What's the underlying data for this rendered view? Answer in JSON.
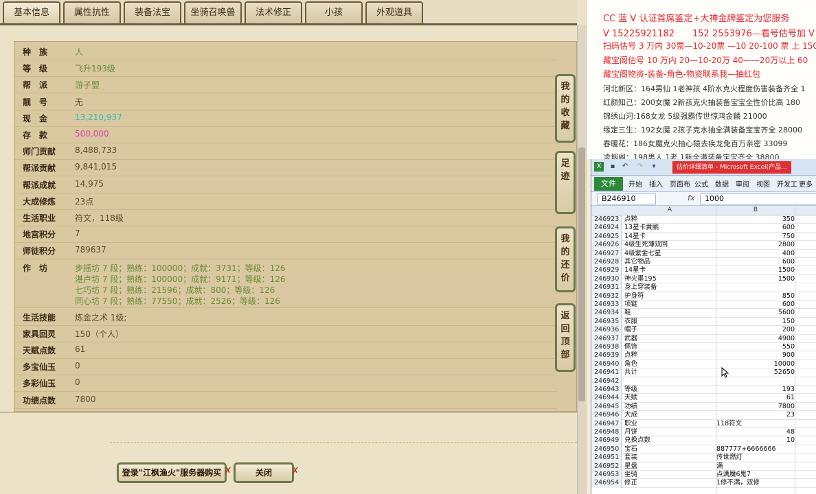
{
  "tabs": [
    "基本信息",
    "属性抗性",
    "装备法宝",
    "坐骑召唤兽",
    "法术修正",
    "小孩",
    "外观道具"
  ],
  "info_rows": [
    {
      "label": "种　族",
      "value": "人",
      "style": "green"
    },
    {
      "label": "等　级",
      "value": "飞升193级",
      "style": "green"
    },
    {
      "label": "帮　派",
      "value": "游子盟",
      "style": "green"
    },
    {
      "label": "靓　号",
      "value": "无",
      "style": "plain"
    },
    {
      "label": "现　金",
      "value": "13,210,937",
      "style": "teal"
    },
    {
      "label": "存　款",
      "value": "500,000",
      "style": "pink"
    },
    {
      "label": "师门贡献",
      "value": "8,488,733",
      "style": "plain"
    },
    {
      "label": "帮派贡献",
      "value": "9,841,015",
      "style": "plain"
    },
    {
      "label": "帮派成就",
      "value": "14,975",
      "style": "plain"
    },
    {
      "label": "大成修炼",
      "value": "23点",
      "style": "plain"
    },
    {
      "label": "生活职业",
      "value": "符文，118级",
      "style": "plain"
    },
    {
      "label": "地宫积分",
      "value": "7",
      "style": "plain"
    },
    {
      "label": "师徒积分",
      "value": "789637",
      "style": "plain"
    }
  ],
  "workshop": {
    "label": "作　坊",
    "lines": [
      "步摇坊 7 段；熟练：100000；成就：3731；等级：126",
      "湛卢坊 7 段；熟练：100000；成就：9171；等级：126",
      "七巧坊 7 段；熟练：21596；成就：800；等级：126",
      "同心坊 7 段；熟练：77550；成就：2526；等级：126"
    ]
  },
  "info_rows_2": [
    {
      "label": "生活技能",
      "value": "炼金之术 1级;"
    },
    {
      "label": "家具回灵",
      "value": "150（个人）"
    },
    {
      "label": "天赋点数",
      "value": "61"
    },
    {
      "label": "多宝仙玉",
      "value": "0"
    },
    {
      "label": "多彩仙玉",
      "value": "0"
    },
    {
      "label": "功绩点数",
      "value": "7800"
    }
  ],
  "side_buttons": [
    {
      "name": "my-favorites",
      "label": "我的收藏"
    },
    {
      "name": "footprints",
      "label": "足迹"
    },
    {
      "name": "my-offers",
      "label": "我的还价"
    },
    {
      "name": "back-to-top",
      "label": "返回顶部"
    }
  ],
  "bottom_buttons": {
    "login": "登录\"江枫渔火\"服务器购买",
    "close": "关闭"
  },
  "ads": [
    "CC 蓝 V 认证首席鉴定+大神金牌鉴定为您服务",
    "V 15225921182　　152 2553976—看号估号加 V",
    "扫码估号 3 万内 30票—10-20票 —10 20-100 票 上 150",
    "藏宝阁估号 10 万内 20—10-20万 40——20万以上 60",
    "藏宝阁物资-装备-角色-物资联系我—抽红包",
    "河北新区：164男仙 1老神孩 4阶水克火程度伤害装备齐全 1",
    "红颜知己：200女魔 2新孩克火抽装备宝宝全性价比高 180",
    "锦绣山河:168女龙 5级强霸传世惊鸿金麟 21000",
    "缘定三生：192女魔 2孩子克水抽全满装备宝宝齐全 28000",
    "春暖花：186女魔克火抽心猿去疾龙免百万亲密 33099",
    "凌烟阁：198男人 1老 1新全满装备宝宝齐全 38800"
  ],
  "excel": {
    "title": "估价详细清单 - Microsoft Excel(产品...",
    "ribbon_tabs": [
      "开始",
      "插入",
      "页面布",
      "公式",
      "数据",
      "审阅",
      "视图",
      "开发工",
      "更多"
    ],
    "file_tab": "文件",
    "name_box": "B246910",
    "fx": "fx",
    "formula_value": "1000",
    "col_a": "A",
    "col_b": "B",
    "rows": [
      [
        "246923",
        "点粹",
        "350"
      ],
      [
        "246924",
        "13星卡黄鹂",
        "600"
      ],
      [
        "246925",
        "14星卡",
        "750"
      ],
      [
        "246926",
        "4级生死薄双回",
        "2800"
      ],
      [
        "246927",
        "4级紫金七星",
        "400"
      ],
      [
        "246928",
        "其它物品",
        "600"
      ],
      [
        "246929",
        "14星卡",
        "1500"
      ],
      [
        "246930",
        "神火墨195",
        "1500"
      ],
      [
        "246931",
        "身上穿装备",
        ""
      ],
      [
        "246932",
        "护身符",
        "850"
      ],
      [
        "246933",
        "项链",
        "600"
      ],
      [
        "246934",
        "鞋",
        "5600"
      ],
      [
        "246935",
        "衣服",
        "150"
      ],
      [
        "246936",
        "帽子",
        "200"
      ],
      [
        "246937",
        "武器",
        "4900"
      ],
      [
        "246938",
        "佩饰",
        "550"
      ],
      [
        "246939",
        "点粹",
        "900"
      ],
      [
        "246940",
        "角色",
        "10000"
      ],
      [
        "246941",
        "共计",
        "52650"
      ],
      [
        "246942",
        "",
        ""
      ],
      [
        "246943",
        "等级",
        "193"
      ],
      [
        "246944",
        "天赋",
        "61"
      ],
      [
        "246945",
        "功绩",
        "7800"
      ],
      [
        "246946",
        "大成",
        "23"
      ],
      [
        "246947",
        "职业",
        "118符文"
      ],
      [
        "246948",
        "月饼",
        "48"
      ],
      [
        "246949",
        "兑换点数",
        "10"
      ],
      [
        "246950",
        "宝石",
        "887777+6666666"
      ],
      [
        "246951",
        "套装",
        "传世燃灯"
      ],
      [
        "246952",
        "星盘",
        "满"
      ],
      [
        "246953",
        "坐骑",
        "点满魔6鬼7"
      ],
      [
        "246954",
        "修正",
        "1修不满，双修"
      ]
    ],
    "left_aligned_b_rows": [
      "246947",
      "246950",
      "246951",
      "246952",
      "246953",
      "246954"
    ]
  }
}
